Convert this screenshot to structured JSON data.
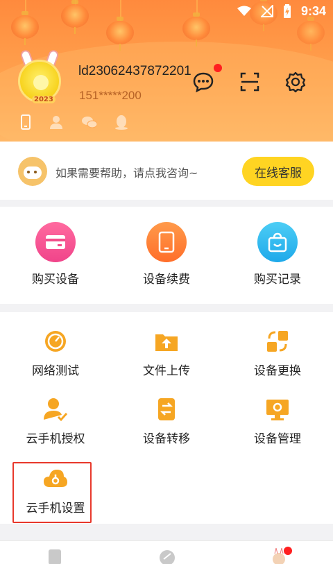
{
  "status": {
    "time": "9:34"
  },
  "profile": {
    "user_id": "ld23062437872201",
    "phone": "151*****200",
    "avatar_year": "2023"
  },
  "help": {
    "text": "如果需要帮助，请点我咨询~",
    "button": "在线客服"
  },
  "row1": [
    {
      "label": "购买设备",
      "icon": "card-icon",
      "color": "#f24d8a"
    },
    {
      "label": "设备续费",
      "icon": "tablet-icon",
      "color": "#ff7a2e"
    },
    {
      "label": "购买记录",
      "icon": "shopping-bag-icon",
      "color": "#2ab6f0"
    }
  ],
  "grid": [
    {
      "label": "网络测试",
      "icon": "speedometer-icon"
    },
    {
      "label": "文件上传",
      "icon": "upload-folder-icon"
    },
    {
      "label": "设备更换",
      "icon": "swap-icon"
    },
    {
      "label": "云手机授权",
      "icon": "user-check-icon"
    },
    {
      "label": "设备转移",
      "icon": "transfer-icon"
    },
    {
      "label": "设备管理",
      "icon": "monitor-gear-icon"
    },
    {
      "label": "云手机设置",
      "icon": "cloud-settings-icon"
    }
  ],
  "colors": {
    "accent_yellow": "#ffd422",
    "icon_orange": "#f6a623",
    "highlight": "#e8382b"
  }
}
